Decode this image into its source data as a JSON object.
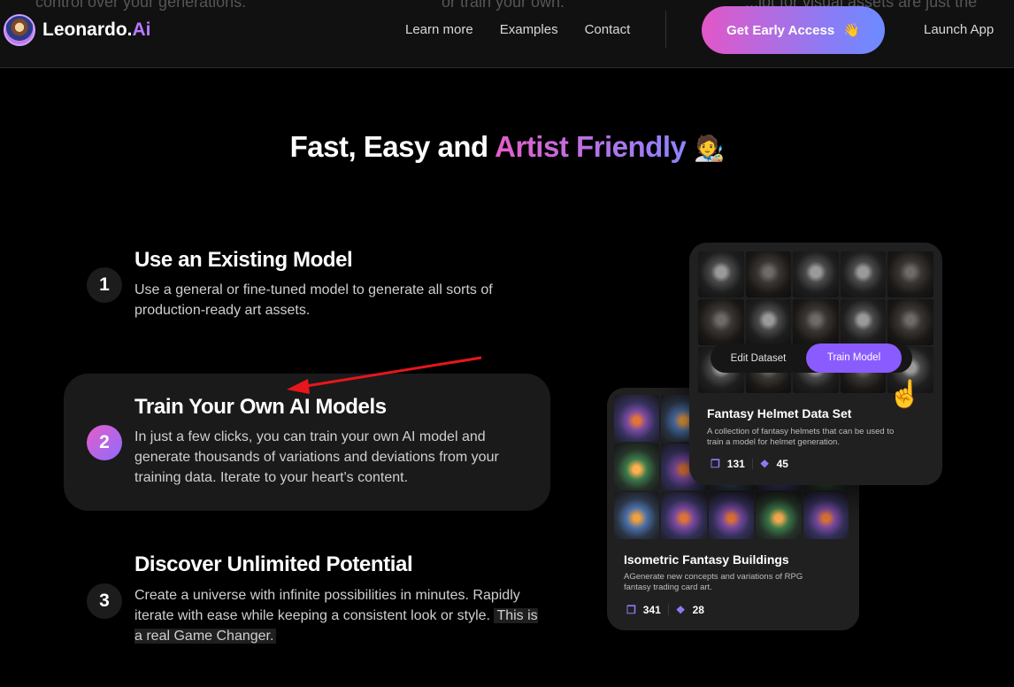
{
  "header": {
    "ghost_text": [
      "control over your generations.",
      "or train your own.",
      "...lot for visual assets are just the"
    ],
    "logo": {
      "name": "Leonardo",
      "dot": ".",
      "suffix": "Ai",
      "icon": "leonardo-logo-icon"
    },
    "nav": [
      "Learn more",
      "Examples",
      "Contact"
    ],
    "cta": {
      "label": "Get Early Access",
      "emoji": "👋"
    },
    "launch": "Launch App"
  },
  "hero": {
    "title_a": "Fast, Easy and ",
    "title_b": "Artist Friendly",
    "emoji": "🧑‍🎨"
  },
  "steps": [
    {
      "number": "1",
      "title": "Use an Existing Model",
      "desc": "Use a general or fine-tuned model to generate all sorts of production-ready art assets.",
      "active": false
    },
    {
      "number": "2",
      "title": "Train Your Own AI Models",
      "desc": "In just a few clicks, you can train your own AI model and generate thousands of variations and deviations from your training data. Iterate to your heart's content.",
      "active": true
    },
    {
      "number": "3",
      "title": "Discover Unlimited Potential",
      "desc": "Create a universe with infinite possibilities in minutes. Rapidly iterate with ease while keeping a consistent look or style.",
      "desc_highlight": "This is a real Game Changer.",
      "active": false
    }
  ],
  "cards": {
    "helmet": {
      "title": "Fantasy Helmet Data Set",
      "desc": "A collection of fantasy helmets that can be used to train a model for helmet generation.",
      "images": "131",
      "models": "45",
      "edit_label": "Edit Dataset",
      "train_label": "Train Model"
    },
    "buildings": {
      "title": "Isometric Fantasy Buildings",
      "desc": "AGenerate new concepts and variations of RPG fantasy trading card art.",
      "images": "341",
      "models": "28"
    }
  },
  "colors": {
    "accent_pink": "#e45ec8",
    "accent_purple": "#8d84ff",
    "arrow": "#e8161b"
  }
}
